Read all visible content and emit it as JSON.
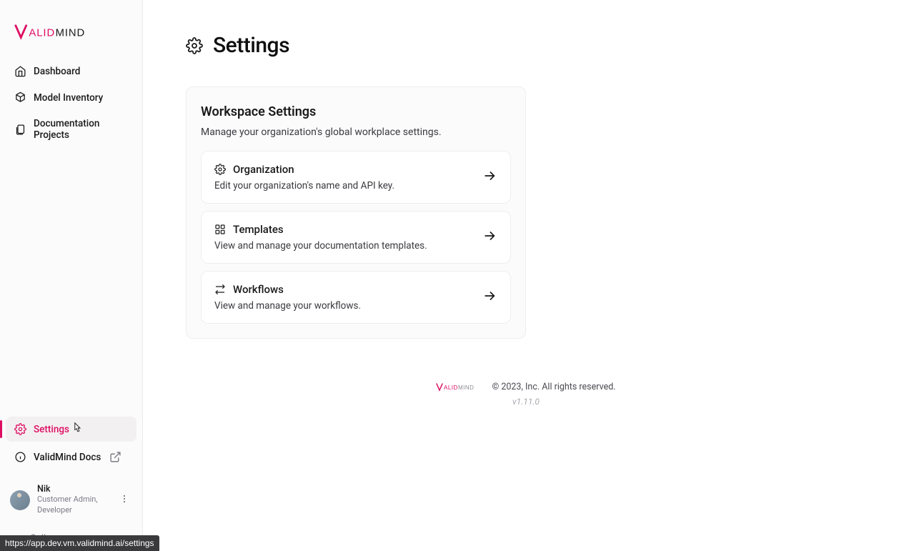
{
  "brand": {
    "name": "ValidMind"
  },
  "sidebar": {
    "top_items": [
      {
        "label": "Dashboard",
        "icon": "home-icon"
      },
      {
        "label": "Model Inventory",
        "icon": "cube-icon"
      },
      {
        "label": "Documentation Projects",
        "icon": "documents-icon"
      }
    ],
    "bottom_items": [
      {
        "label": "Settings",
        "icon": "gear-icon",
        "active": true
      },
      {
        "label": "ValidMind Docs",
        "icon": "info-icon",
        "external": true
      }
    ],
    "user": {
      "name": "Nik",
      "role": "Customer Admin, Developer"
    },
    "collapse_label": "Collapse"
  },
  "page": {
    "title": "Settings"
  },
  "workspace": {
    "title": "Workspace Settings",
    "description": "Manage your organization's global workplace settings.",
    "items": [
      {
        "title": "Organization",
        "description": "Edit your organization's name and API key."
      },
      {
        "title": "Templates",
        "description": "View and manage your documentation templates."
      },
      {
        "title": "Workflows",
        "description": "View and manage your workflows."
      }
    ]
  },
  "footer": {
    "copyright": "© 2023, Inc. All rights reserved.",
    "version": "v1.11.0"
  },
  "status_url": "https://app.dev.vm.validmind.ai/settings"
}
